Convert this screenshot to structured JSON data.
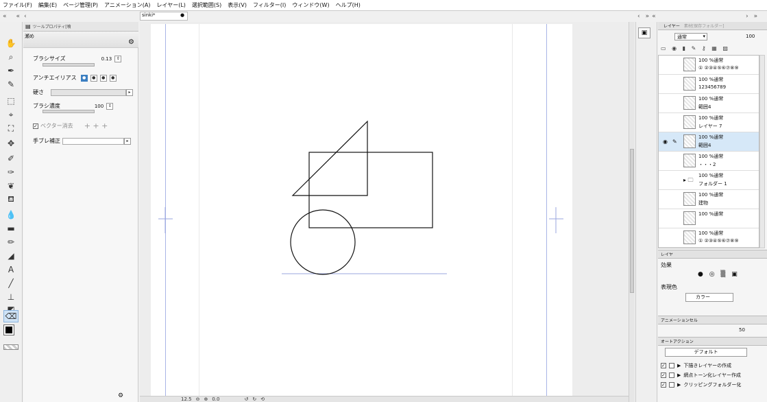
{
  "menubar": {
    "items": [
      "ファイル(F)",
      "編集(E)",
      "ページ管理(P)",
      "アニメーション(A)",
      "レイヤー(L)",
      "選択範囲(S)",
      "表示(V)",
      "フィルター(I)",
      "ウィンドウ(W)",
      "ヘルプ(H)"
    ]
  },
  "document": {
    "tab_label": "sinki*"
  },
  "tool_property": {
    "tab_label": "ツールプロパティ[噴",
    "tool_name": "瀬め",
    "brush_size_label": "ブラシサイズ",
    "brush_size_value": "0.13",
    "antialias_label": "アンチエイリアス",
    "hardness_label": "硬さ",
    "brush_density_label": "ブラシ濃度",
    "brush_density_value": "100",
    "vector_erase_label": "ベクター消去",
    "stabilization_label": "手ブレ補正"
  },
  "statusbar": {
    "zoom": "12.5",
    "angle": "0.0"
  },
  "layer_panel": {
    "tab_label": "レイヤー",
    "tab2_label": "素材[保存フォルダー]",
    "blend_mode": "通常",
    "opacity": "100",
    "layers": [
      {
        "top": "100 %通常",
        "name": "① ②③④⑤⑥⑦⑧⑨"
      },
      {
        "top": "100 %通常",
        "name": "123456789"
      },
      {
        "top": "100 %通常",
        "name": "範囲4"
      },
      {
        "top": "100 %通常",
        "name": "レイヤー 7"
      },
      {
        "top": "100 %通常",
        "name": "範囲4"
      },
      {
        "top": "100 %通常",
        "name": "・・・2"
      },
      {
        "top": "100 %通常",
        "name": "フォルダー 1"
      },
      {
        "top": "100 %通常",
        "name": "建物"
      },
      {
        "top": "100 %通常",
        "name": ""
      },
      {
        "top": "100 %通常",
        "name": "① ②③④⑤⑥⑦⑧⑨"
      }
    ]
  },
  "effect_panel": {
    "tab_label": "レイヤ",
    "effect_label": "効果",
    "color_label": "表現色",
    "color_value": "カラー"
  },
  "animation_panel": {
    "tab_label": "アニメーションセル",
    "value": "50"
  },
  "auto_action": {
    "tab_label": "オートアクション",
    "set_name": "デフォルト",
    "items": [
      "下描きレイヤーの作成",
      "網点トーン化レイヤー作成",
      "クリッピングフォルダー化"
    ]
  },
  "colors": {
    "accent": "#3c7fc1",
    "selection": "#d6e8f8",
    "guide": "#a8b4e6"
  }
}
